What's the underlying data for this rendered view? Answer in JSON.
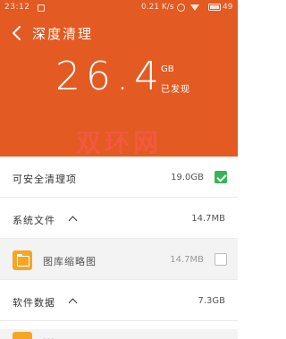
{
  "status_bar": {
    "time": "23:12",
    "speed": "0.21 K/s",
    "battery": "49"
  },
  "header": {
    "back_icon": "chevron-left-icon",
    "title": "深度清理",
    "size_value": "26.4",
    "size_unit": "GB",
    "size_caption": "已发现",
    "background_color": "#e35a22"
  },
  "watermark": "双环网",
  "items": [
    {
      "label": "可安全清理项",
      "size": "19.0GB",
      "checked": true
    },
    {
      "label": "系统文件",
      "size": "14.7MB",
      "expanded": true
    },
    {
      "label": "图库缩略图",
      "size": "14.7MB",
      "checked": false,
      "icon": "folder-icon"
    },
    {
      "label": "软件数据",
      "size": "7.3GB",
      "expanded": true
    }
  ],
  "partial_item": {
    "label": "..."
  },
  "colors": {
    "accent": "#e35a22",
    "check_green": "#35b556",
    "folder_orange": "#f5a623"
  }
}
